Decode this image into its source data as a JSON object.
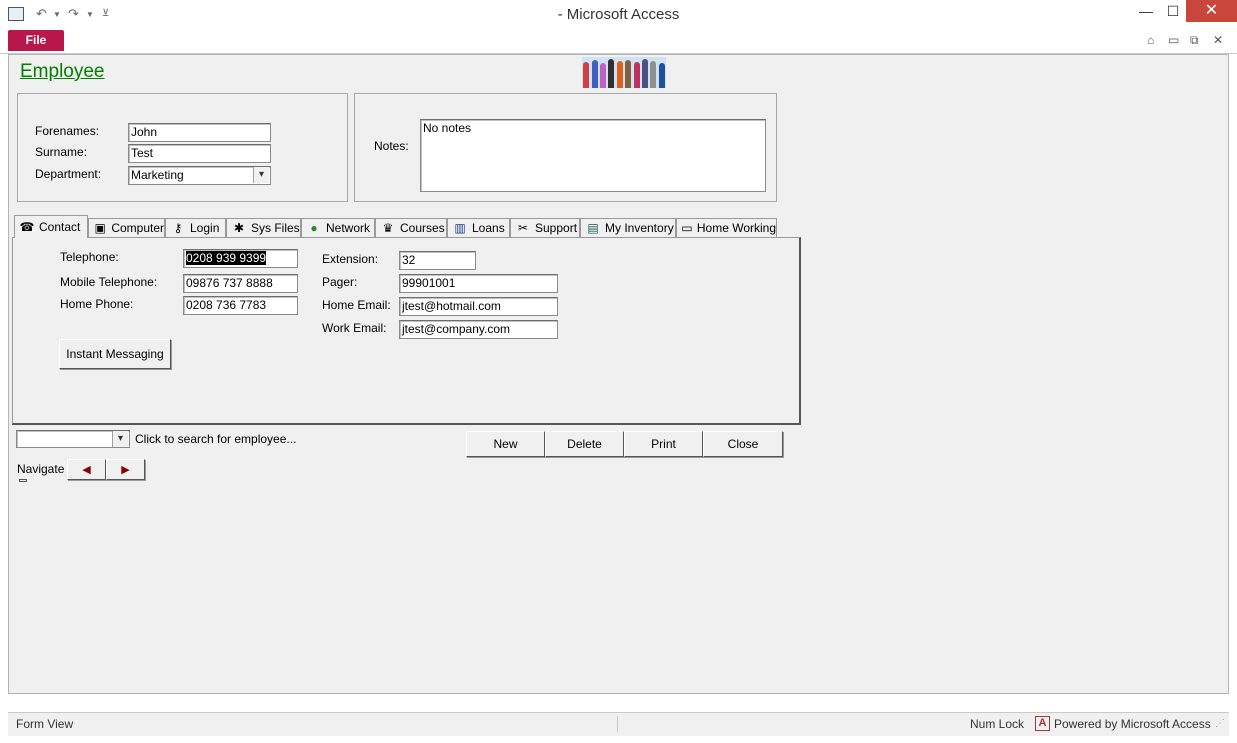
{
  "window": {
    "title": "- Microsoft Access",
    "min": "—",
    "max": "☐",
    "close": "✕"
  },
  "ribbon": {
    "file_label": "File",
    "restore_ribbon": "⌂",
    "doc_min": "▭",
    "doc_restore": "⧉",
    "doc_close": "✕"
  },
  "form": {
    "title": "Employee",
    "forenames_label": "Forenames:",
    "forenames_value": "John",
    "surname_label": "Surname:",
    "surname_value": "Test",
    "department_label": "Department:",
    "department_value": "Marketing",
    "notes_label": "Notes:",
    "notes_value": "No notes"
  },
  "tabs": [
    {
      "label": "Contact",
      "icon": "telephone-icon",
      "glyph": "☎"
    },
    {
      "label": "Computer",
      "icon": "floppy-icon",
      "glyph": "▣"
    },
    {
      "label": "Login",
      "icon": "key-icon",
      "glyph": "⚷"
    },
    {
      "label": "Sys Files",
      "icon": "folder-star-icon",
      "glyph": "✱"
    },
    {
      "label": "Network",
      "icon": "globe-icon",
      "glyph": "●"
    },
    {
      "label": "Courses",
      "icon": "cap-icon",
      "glyph": "♛"
    },
    {
      "label": "Loans",
      "icon": "book-icon",
      "glyph": "▥"
    },
    {
      "label": "Support",
      "icon": "tools-icon",
      "glyph": "✂"
    },
    {
      "label": "My Inventory",
      "icon": "inventory-icon",
      "glyph": "▤"
    },
    {
      "label": "Home Working",
      "icon": "home-working-icon",
      "glyph": "▭"
    }
  ],
  "contact": {
    "telephone_label": "Telephone:",
    "telephone_value": "0208 939 9399",
    "mobile_label": "Mobile Telephone:",
    "mobile_value": "09876 737 8888",
    "home_phone_label": "Home Phone:",
    "home_phone_value": "0208 736 7783",
    "extension_label": "Extension:",
    "extension_value": "32",
    "pager_label": "Pager:",
    "pager_value": "99901001",
    "home_email_label": "Home Email:",
    "home_email_value": "jtest@hotmail.com",
    "work_email_label": "Work Email:",
    "work_email_value": "jtest@company.com",
    "im_button": "Instant Messaging"
  },
  "search": {
    "hint": "Click to search for employee..."
  },
  "actions": {
    "new": "New",
    "delete": "Delete",
    "print": "Print",
    "close": "Close"
  },
  "navigate": {
    "label": "Navigate",
    "prev": "◀",
    "next": "▶"
  },
  "status": {
    "view": "Form View",
    "numlock": "Num Lock",
    "powered": "Powered by Microsoft Access"
  },
  "colors": {
    "file_tab": "#b8174a",
    "title_green": "#008000",
    "close_red": "#c9463d",
    "nav_arrow": "#8b0000"
  }
}
